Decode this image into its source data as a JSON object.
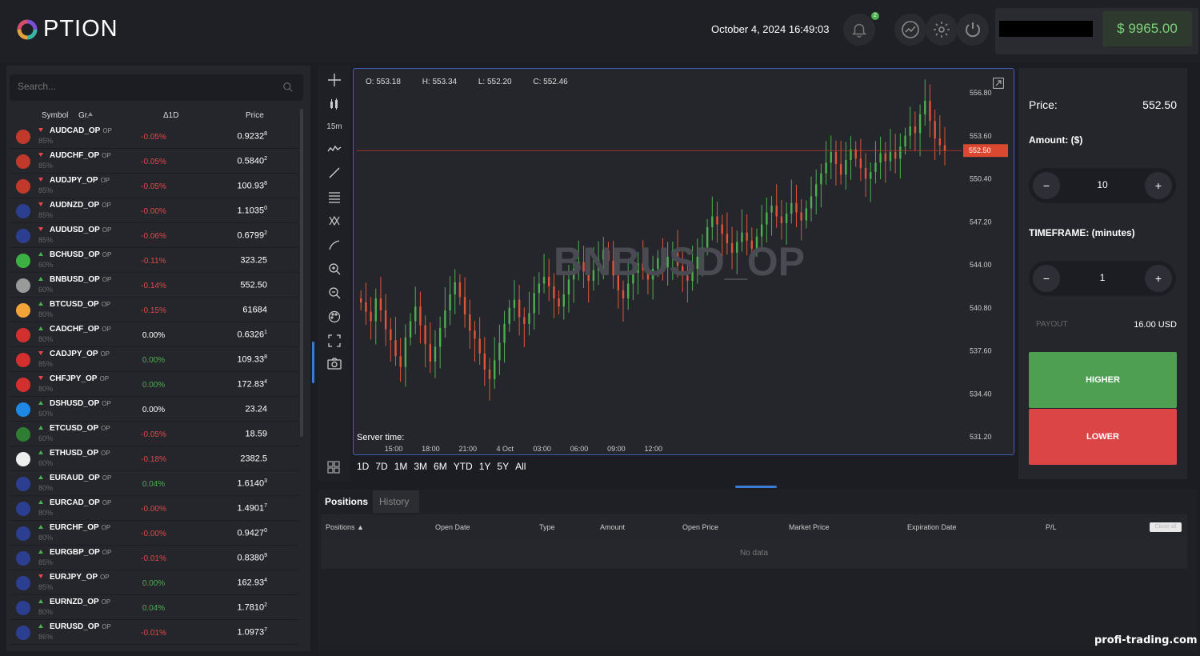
{
  "app": {
    "logo_text": "PTION"
  },
  "header": {
    "datetime": "October 4, 2024 16:49:03",
    "notifications_count": "2",
    "balance": "$ 9965.00"
  },
  "search": {
    "placeholder": "Search..."
  },
  "list": {
    "headers": {
      "symbol": "Symbol",
      "group": "Gr.",
      "change": "Δ1D",
      "price": "Price"
    },
    "rows": [
      {
        "symbol": "AUDCAD_OP",
        "tag": "OP",
        "pct": "85%",
        "dir": "down",
        "change": "-0.05%",
        "tone": "neg",
        "price_main": "0.9232",
        "price_sup": "8",
        "color": "#c0392b"
      },
      {
        "symbol": "AUDCHF_OP",
        "tag": "OP",
        "pct": "85%",
        "dir": "down",
        "change": "-0.05%",
        "tone": "neg",
        "price_main": "0.5840",
        "price_sup": "2",
        "color": "#c0392b"
      },
      {
        "symbol": "AUDJPY_OP",
        "tag": "OP",
        "pct": "85%",
        "dir": "down",
        "change": "-0.05%",
        "tone": "neg",
        "price_main": "100.93",
        "price_sup": "8",
        "color": "#c0392b"
      },
      {
        "symbol": "AUDNZD_OP",
        "tag": "OP",
        "pct": "85%",
        "dir": "down",
        "change": "-0.00%",
        "tone": "neg",
        "price_main": "1.1035",
        "price_sup": "0",
        "color": "#2c3e8f"
      },
      {
        "symbol": "AUDUSD_OP",
        "tag": "OP",
        "pct": "85%",
        "dir": "down",
        "change": "-0.06%",
        "tone": "neg",
        "price_main": "0.6799",
        "price_sup": "2",
        "color": "#2c3e8f"
      },
      {
        "symbol": "BCHUSD_OP",
        "tag": "OP",
        "pct": "60%",
        "dir": "up",
        "change": "-0.11%",
        "tone": "neg",
        "price_main": "323.25",
        "price_sup": "",
        "color": "#3cb043"
      },
      {
        "symbol": "BNBUSD_OP",
        "tag": "OP",
        "pct": "60%",
        "dir": "up",
        "change": "-0.14%",
        "tone": "neg",
        "price_main": "552.50",
        "price_sup": "",
        "color": "#9a9a9a"
      },
      {
        "symbol": "BTCUSD_OP",
        "tag": "OP",
        "pct": "80%",
        "dir": "up",
        "change": "-0.15%",
        "tone": "neg",
        "price_main": "61684",
        "price_sup": "",
        "color": "#f2a33a"
      },
      {
        "symbol": "CADCHF_OP",
        "tag": "OP",
        "pct": "80%",
        "dir": "up",
        "change": "0.00%",
        "tone": "neu",
        "price_main": "0.6326",
        "price_sup": "1",
        "color": "#d32f2f"
      },
      {
        "symbol": "CADJPY_OP",
        "tag": "OP",
        "pct": "85%",
        "dir": "down",
        "change": "0.00%",
        "tone": "pos",
        "price_main": "109.33",
        "price_sup": "8",
        "color": "#d32f2f"
      },
      {
        "symbol": "CHFJPY_OP",
        "tag": "OP",
        "pct": "80%",
        "dir": "down",
        "change": "0.00%",
        "tone": "pos",
        "price_main": "172.83",
        "price_sup": "4",
        "color": "#d32f2f"
      },
      {
        "symbol": "DSHUSD_OP",
        "tag": "OP",
        "pct": "60%",
        "dir": "up",
        "change": "0.00%",
        "tone": "neu",
        "price_main": "23.24",
        "price_sup": "",
        "color": "#1e88e5"
      },
      {
        "symbol": "ETCUSD_OP",
        "tag": "OP",
        "pct": "60%",
        "dir": "up",
        "change": "-0.05%",
        "tone": "neg",
        "price_main": "18.59",
        "price_sup": "",
        "color": "#2e7d32"
      },
      {
        "symbol": "ETHUSD_OP",
        "tag": "OP",
        "pct": "60%",
        "dir": "up",
        "change": "-0.18%",
        "tone": "neg",
        "price_main": "2382.5",
        "price_sup": "",
        "color": "#eeeeee"
      },
      {
        "symbol": "EURAUD_OP",
        "tag": "OP",
        "pct": "80%",
        "dir": "up",
        "change": "0.04%",
        "tone": "pos",
        "price_main": "1.6140",
        "price_sup": "3",
        "color": "#2c3e8f"
      },
      {
        "symbol": "EURCAD_OP",
        "tag": "OP",
        "pct": "80%",
        "dir": "up",
        "change": "-0.00%",
        "tone": "neg",
        "price_main": "1.4901",
        "price_sup": "7",
        "color": "#2c3e8f"
      },
      {
        "symbol": "EURCHF_OP",
        "tag": "OP",
        "pct": "80%",
        "dir": "up",
        "change": "-0.00%",
        "tone": "neg",
        "price_main": "0.9427",
        "price_sup": "0",
        "color": "#2c3e8f"
      },
      {
        "symbol": "EURGBP_OP",
        "tag": "OP",
        "pct": "85%",
        "dir": "up",
        "change": "-0.01%",
        "tone": "neg",
        "price_main": "0.8380",
        "price_sup": "9",
        "color": "#2c3e8f"
      },
      {
        "symbol": "EURJPY_OP",
        "tag": "OP",
        "pct": "85%",
        "dir": "down",
        "change": "0.00%",
        "tone": "pos",
        "price_main": "162.93",
        "price_sup": "4",
        "color": "#2c3e8f"
      },
      {
        "symbol": "EURNZD_OP",
        "tag": "OP",
        "pct": "80%",
        "dir": "up",
        "change": "0.04%",
        "tone": "pos",
        "price_main": "1.7810",
        "price_sup": "2",
        "color": "#2c3e8f"
      },
      {
        "symbol": "EURUSD_OP",
        "tag": "OP",
        "pct": "86%",
        "dir": "up",
        "change": "-0.01%",
        "tone": "neg",
        "price_main": "1.0973",
        "price_sup": "7",
        "color": "#2c3e8f"
      }
    ]
  },
  "toolbar": {
    "timeframe": "15m"
  },
  "chart": {
    "ohlc": {
      "o": "O: 553.18",
      "h": "H: 553.34",
      "l": "L: 552.20",
      "c": "C: 552.46"
    },
    "watermark": "BNBUSD_OP",
    "server_time_label": "Server time:",
    "ranges": [
      "1D",
      "7D",
      "1M",
      "3M",
      "6M",
      "YTD",
      "1Y",
      "5Y",
      "All"
    ]
  },
  "chart_data": {
    "type": "candlestick",
    "title": "BNBUSD_OP",
    "x_ticks": [
      "15:00",
      "18:00",
      "21:00",
      "4 Oct",
      "03:00",
      "06:00",
      "09:00",
      "12:00"
    ],
    "y_ticks": [
      "556.80",
      "553.60",
      "550.40",
      "547.20",
      "544.00",
      "540.80",
      "537.60",
      "534.40",
      "531.20"
    ],
    "ylim": [
      531.2,
      556.8
    ],
    "current_price": "552.50",
    "up_color": "#4caf50",
    "down_color": "#e0553a",
    "closes": [
      541.2,
      540.5,
      539.8,
      541.5,
      540.6,
      539.2,
      538.4,
      537.2,
      536.4,
      538.6,
      539.8,
      540.9,
      539.5,
      538.1,
      536.8,
      537.9,
      539.3,
      540.6,
      541.8,
      542.7,
      541.6,
      540.3,
      539.1,
      538.5,
      537.4,
      536.2,
      535.5,
      536.9,
      538.2,
      539.6,
      540.8,
      541.4,
      540.1,
      539.6,
      540.4,
      541.9,
      542.6,
      543.1,
      542.4,
      541.5,
      540.9,
      541.8,
      542.9,
      543.7,
      544.2,
      543.5,
      542.8,
      543.6,
      544.4,
      545.1,
      544.3,
      543.2,
      542.1,
      541.5,
      542.6,
      543.4,
      544.1,
      543.6,
      542.9,
      543.7,
      544.5,
      543.8,
      544.6,
      545.0,
      543.9,
      543.2,
      542.8,
      543.7,
      544.6,
      545.3,
      546.8,
      547.6,
      547.0,
      546.3,
      545.6,
      544.9,
      545.7,
      546.4,
      545.8,
      545.2,
      546.1,
      547.0,
      547.9,
      548.4,
      547.6,
      547.1,
      547.8,
      548.6,
      547.9,
      547.3,
      548.2,
      549.1,
      550.0,
      550.8,
      551.6,
      552.4,
      551.5,
      550.7,
      551.8,
      552.6,
      551.9,
      551.2,
      550.4,
      550.9,
      551.6,
      552.3,
      551.7,
      552.4,
      551.9,
      552.8,
      553.6,
      554.3,
      553.8,
      555.2,
      556.2,
      554.7,
      553.4,
      552.9,
      552.5
    ],
    "opens": [
      541.5,
      541.2,
      540.5,
      539.8,
      541.5,
      540.6,
      539.2,
      538.4,
      537.2,
      536.4,
      538.6,
      539.8,
      540.9,
      539.5,
      538.1,
      536.8,
      537.9,
      539.3,
      540.6,
      541.8,
      542.7,
      541.6,
      540.3,
      539.1,
      538.5,
      537.4,
      536.2,
      535.5,
      536.9,
      538.2,
      539.6,
      540.8,
      541.4,
      540.1,
      539.6,
      540.4,
      541.9,
      542.6,
      543.1,
      542.4,
      541.5,
      540.9,
      541.8,
      542.9,
      543.7,
      544.2,
      543.5,
      542.8,
      543.6,
      544.4,
      545.1,
      544.3,
      543.2,
      542.1,
      541.5,
      542.6,
      543.4,
      544.1,
      543.6,
      542.9,
      543.7,
      544.5,
      543.8,
      544.6,
      545.0,
      543.9,
      543.2,
      542.8,
      543.7,
      544.6,
      545.3,
      546.8,
      547.6,
      547.0,
      546.3,
      545.6,
      544.9,
      545.7,
      546.4,
      545.8,
      545.2,
      546.1,
      547.0,
      547.9,
      548.4,
      547.6,
      547.1,
      547.8,
      548.6,
      547.9,
      547.3,
      548.2,
      549.1,
      550.0,
      550.8,
      551.6,
      552.4,
      551.5,
      550.7,
      551.8,
      552.6,
      551.9,
      551.2,
      550.4,
      550.9,
      551.6,
      552.3,
      551.7,
      552.4,
      551.9,
      552.8,
      553.6,
      554.3,
      553.8,
      555.2,
      556.2,
      554.7,
      553.4,
      552.9
    ]
  },
  "trade": {
    "price_label": "Price:",
    "price_value": "552.50",
    "amount_label": "Amount: ($)",
    "amount_value": "10",
    "timeframe_label": "TIMEFRAME: (minutes)",
    "timeframe_value": "1",
    "minus": "−",
    "plus": "+",
    "payout_label": "PAYOUT",
    "payout_value": "16.00 USD",
    "higher": "HIGHER",
    "lower": "LOWER"
  },
  "positions": {
    "tab_positions": "Positions",
    "tab_history": "History",
    "columns": [
      "Positions ▲",
      "Open Date",
      "Type",
      "Amount",
      "Open Price",
      "Market Price",
      "Expiration Date",
      "P/L"
    ],
    "close_all": "Close all",
    "empty": "No data"
  },
  "footer": {
    "site": "profi-trading.com"
  }
}
